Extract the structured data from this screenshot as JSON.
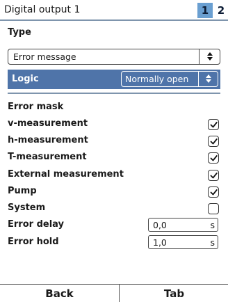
{
  "header": {
    "title": "Digital output 1",
    "tabs": [
      "1",
      "2"
    ],
    "active_tab": "1",
    "accent_color": "#6a9fd1"
  },
  "type_section": {
    "label": "Type",
    "selected": "Error message"
  },
  "logic": {
    "label": "Logic",
    "selected": "Normally open",
    "highlight_color": "#4f74a9"
  },
  "error_mask": {
    "title": "Error mask",
    "items": [
      {
        "label": "v-measurement",
        "checked": true
      },
      {
        "label": "h-measurement",
        "checked": true
      },
      {
        "label": "T-measurement",
        "checked": true
      },
      {
        "label": "External measurement",
        "checked": true
      },
      {
        "label": "Pump",
        "checked": true
      },
      {
        "label": "System",
        "checked": false
      }
    ]
  },
  "error_delay": {
    "label": "Error delay",
    "value": "0,0",
    "unit": "s"
  },
  "error_hold": {
    "label": "Error hold",
    "value": "1,0",
    "unit": "s"
  },
  "softkeys": {
    "left": "Back",
    "right": "Tab"
  },
  "icons": {
    "checkbox_checked": "checkmark-icon",
    "select_arrows": "updown-arrows-icon"
  }
}
